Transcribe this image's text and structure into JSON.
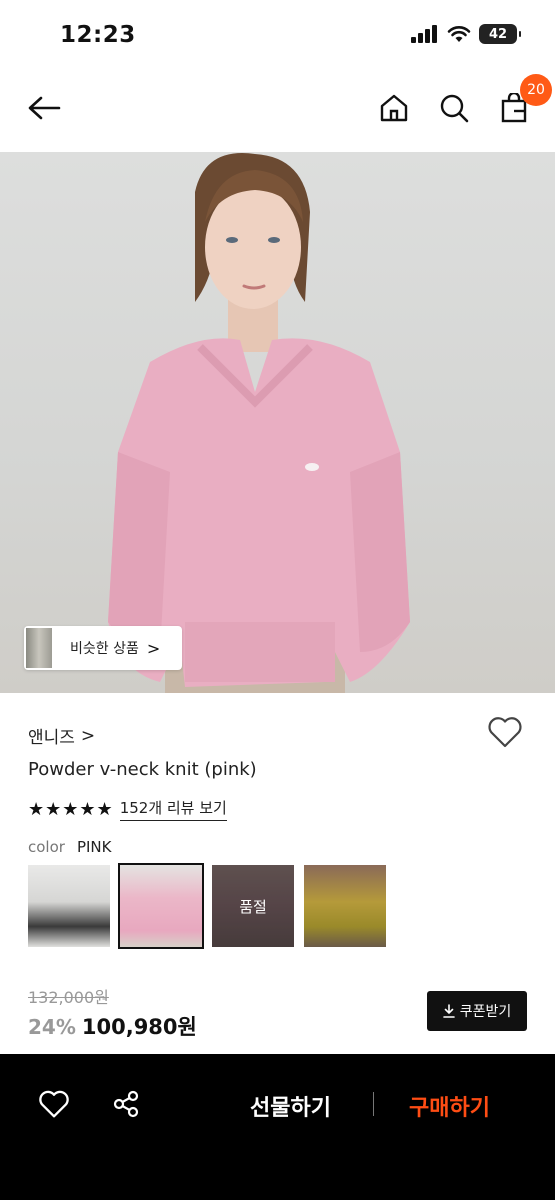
{
  "status_bar": {
    "time": "12:23",
    "battery": "42"
  },
  "nav": {
    "cart_count": "20"
  },
  "hero": {
    "similar_label": "비슷한 상품",
    "similar_chevron": ">"
  },
  "product": {
    "brand": "앤니즈",
    "brand_chevron": ">",
    "name": "Powder v-neck knit (pink)",
    "stars": "★★★★★",
    "rating": 5,
    "review_link": "152개 리뷰 보기",
    "color_key": "color",
    "color_value": "PINK",
    "swatches": [
      {
        "selected": false,
        "soldout": false
      },
      {
        "selected": true,
        "soldout": false
      },
      {
        "selected": false,
        "soldout": true,
        "label": "품절"
      },
      {
        "selected": false,
        "soldout": false
      }
    ],
    "original_price": "132,000원",
    "discount": "24%",
    "sale_price": "100,980원",
    "coupon_label": "쿠폰받기"
  },
  "bottom_bar": {
    "gift_label": "선물하기",
    "buy_label": "구매하기"
  },
  "colors": {
    "accent": "#ff5a16",
    "buy": "#ff4d14",
    "black": "#000000"
  }
}
